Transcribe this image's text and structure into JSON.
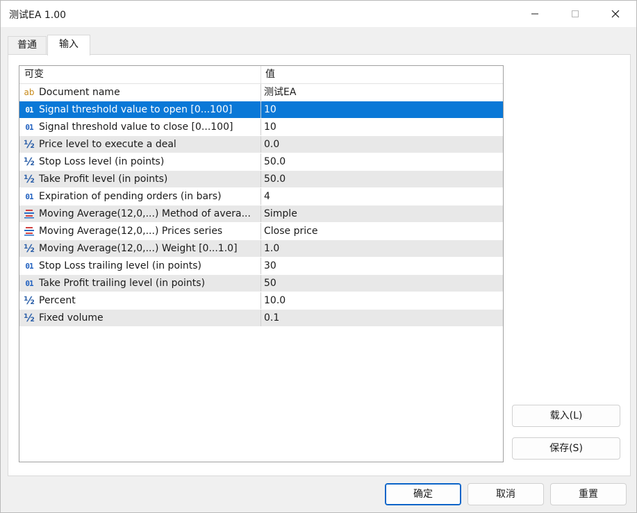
{
  "window": {
    "title": "测试EA 1.00"
  },
  "tabs": [
    {
      "label": "普通"
    },
    {
      "label": "输入"
    }
  ],
  "grid": {
    "columns": [
      "可变",
      "值"
    ],
    "rows": [
      {
        "type": "string",
        "icon_label": "ab",
        "name": "Document name",
        "value": "测试EA"
      },
      {
        "type": "integer",
        "icon_label": "01",
        "name": "Signal threshold value to open [0...100]",
        "value": "10"
      },
      {
        "type": "integer",
        "icon_label": "01",
        "name": "Signal threshold value to close [0...100]",
        "value": "10"
      },
      {
        "type": "double",
        "icon_label": "½",
        "name": "Price level to execute a deal",
        "value": "0.0"
      },
      {
        "type": "double",
        "icon_label": "½",
        "name": "Stop Loss level (in points)",
        "value": "50.0"
      },
      {
        "type": "double",
        "icon_label": "½",
        "name": "Take Profit level (in points)",
        "value": "50.0"
      },
      {
        "type": "integer",
        "icon_label": "01",
        "name": "Expiration of pending orders (in bars)",
        "value": "4"
      },
      {
        "type": "enum",
        "icon_label": "",
        "name": "Moving Average(12,0,...) Method of avera...",
        "value": "Simple"
      },
      {
        "type": "enum",
        "icon_label": "",
        "name": "Moving Average(12,0,...) Prices series",
        "value": "Close price"
      },
      {
        "type": "double",
        "icon_label": "½",
        "name": "Moving Average(12,0,...) Weight [0...1.0]",
        "value": "1.0"
      },
      {
        "type": "integer",
        "icon_label": "01",
        "name": "Stop Loss trailing level (in points)",
        "value": "30"
      },
      {
        "type": "integer",
        "icon_label": "01",
        "name": "Take Profit trailing level (in points)",
        "value": "50"
      },
      {
        "type": "double",
        "icon_label": "½",
        "name": "Percent",
        "value": "10.0"
      },
      {
        "type": "double",
        "icon_label": "½",
        "name": "Fixed volume",
        "value": "0.1"
      }
    ],
    "selected_row": 1
  },
  "side_buttons": {
    "load": "载入(L)",
    "save": "保存(S)"
  },
  "footer_buttons": {
    "ok": "确定",
    "cancel": "取消",
    "reset": "重置"
  },
  "colors": {
    "selection": "#0a78d7",
    "alt_row": "#e8e8e8",
    "int_icon": "#1f5fbf",
    "str_icon": "#c78a1a",
    "enum_icon_red": "#d04040",
    "enum_icon_blue": "#2a6fc9"
  }
}
